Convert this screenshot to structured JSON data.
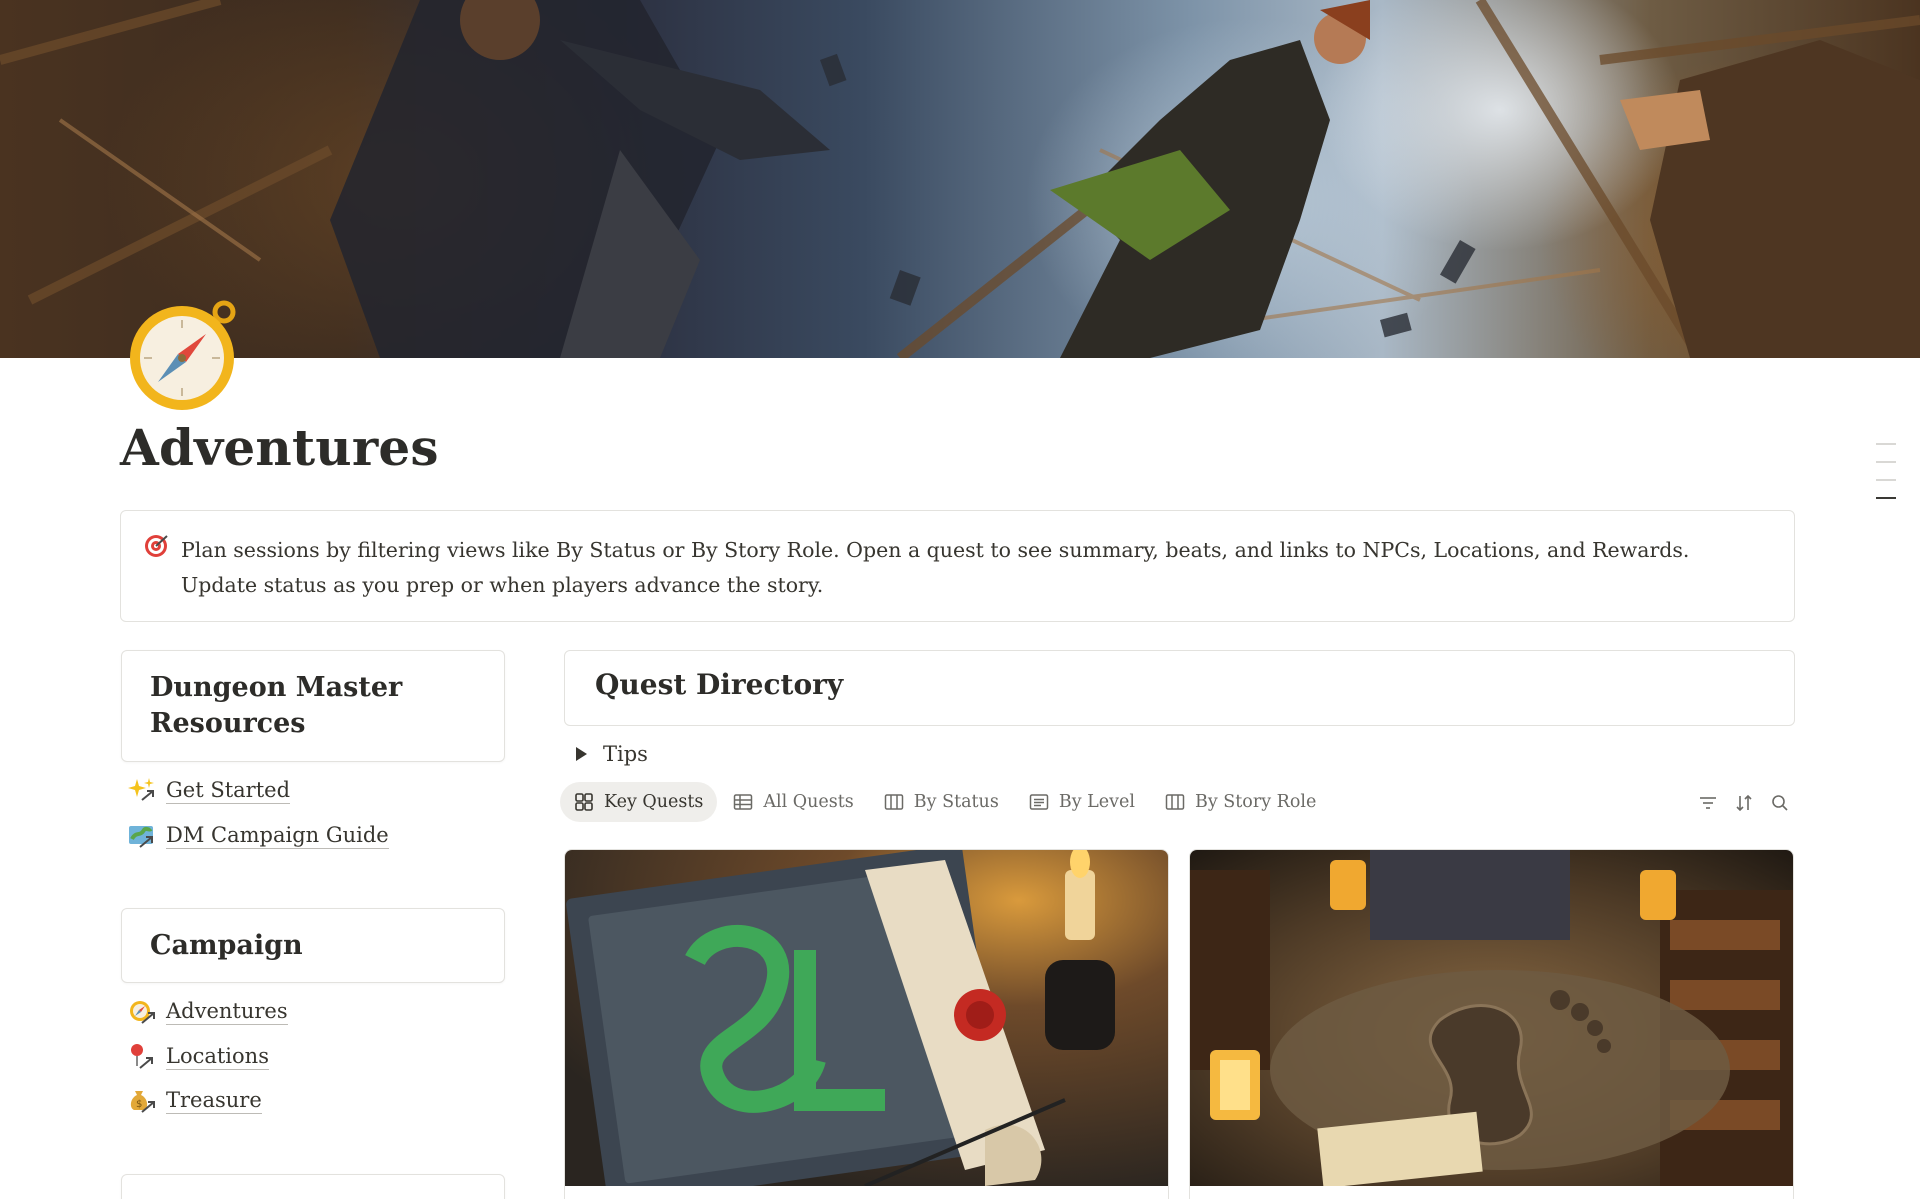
{
  "page": {
    "title": "Adventures",
    "icon": "compass-icon"
  },
  "callout": {
    "icon": "target-icon",
    "text": "Plan sessions by filtering views like By Status or By Story Role. Open a quest to see summary, beats, and links to NPCs, Locations, and Rewards. Update status as you prep or when players advance the story."
  },
  "sidebar": {
    "sections": [
      {
        "title": "Dungeon Master Resources",
        "links": [
          {
            "icon": "sparkles-icon",
            "label": "Get Started"
          },
          {
            "icon": "map-icon",
            "label": "DM Campaign Guide"
          }
        ]
      },
      {
        "title": "Campaign",
        "links": [
          {
            "icon": "compass-icon",
            "label": "Adventures"
          },
          {
            "icon": "pin-icon",
            "label": "Locations"
          },
          {
            "icon": "money-bag-icon",
            "label": "Treasure"
          }
        ]
      }
    ]
  },
  "quest_directory": {
    "title": "Quest Directory",
    "toggle_label": "Tips",
    "views": [
      {
        "icon": "gallery-icon",
        "label": "Key Quests",
        "active": true
      },
      {
        "icon": "table-icon",
        "label": "All Quests",
        "active": false
      },
      {
        "icon": "board-icon",
        "label": "By Status",
        "active": false
      },
      {
        "icon": "list-icon",
        "label": "By Level",
        "active": false
      },
      {
        "icon": "board-icon",
        "label": "By Story Role",
        "active": false
      }
    ],
    "tools": [
      "filter-icon",
      "sort-icon",
      "search-icon"
    ],
    "cards": [
      {
        "cover": "sealed-letter-illustration"
      },
      {
        "cover": "footprint-archive-illustration"
      }
    ]
  },
  "colors": {
    "text": "#37352f",
    "muted": "#6b6a66",
    "border": "#e3e2de",
    "active_tab_bg": "#efeeeb"
  }
}
